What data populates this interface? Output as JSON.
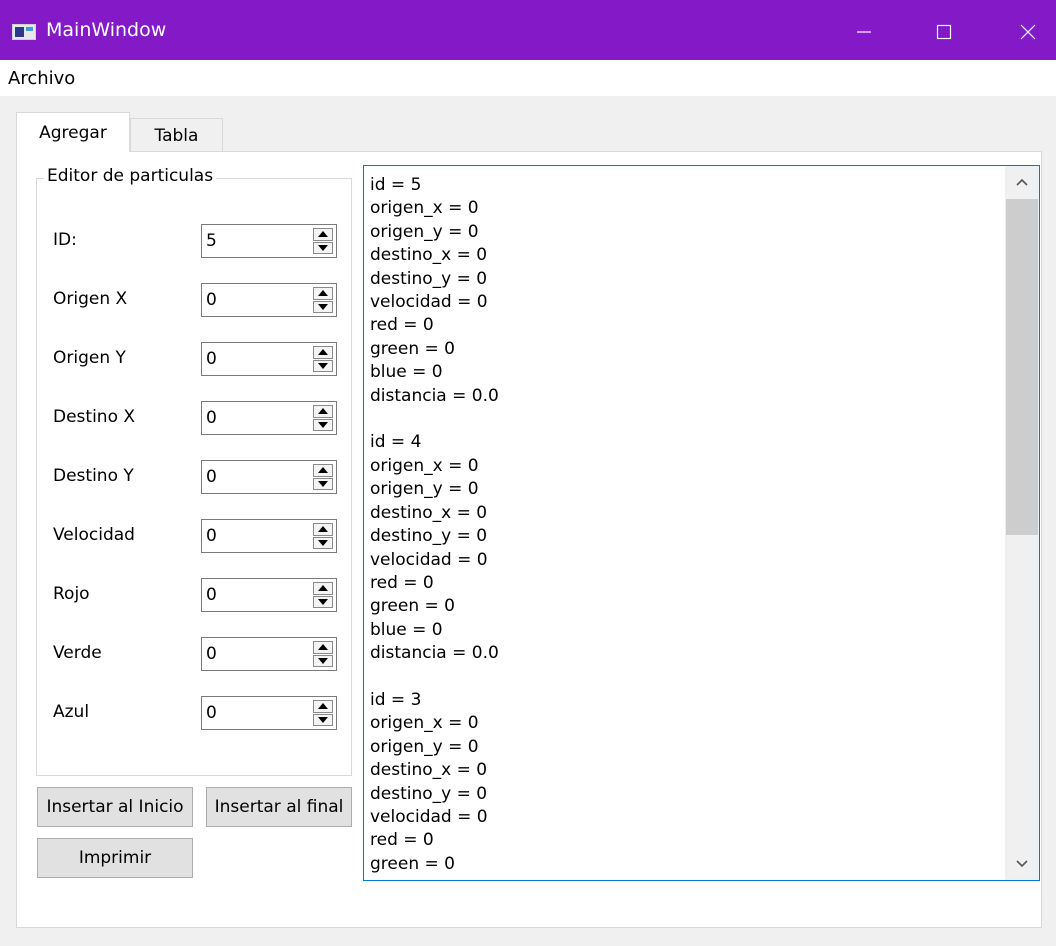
{
  "window": {
    "title": "MainWindow",
    "colors": {
      "titlebar": "#8419c7",
      "focus_border": "#0078d7"
    }
  },
  "menu": {
    "items": [
      "Archivo"
    ]
  },
  "tabs": [
    {
      "label": "Agregar",
      "active": true
    },
    {
      "label": "Tabla",
      "active": false
    }
  ],
  "editor": {
    "group_title": "Editor de particulas",
    "fields": [
      {
        "label": "ID:",
        "value": "5"
      },
      {
        "label": "Origen X",
        "value": "0"
      },
      {
        "label": "Origen Y",
        "value": "0"
      },
      {
        "label": "Destino X",
        "value": "0"
      },
      {
        "label": "Destino Y",
        "value": "0"
      },
      {
        "label": "Velocidad",
        "value": "0"
      },
      {
        "label": "Rojo",
        "value": "0"
      },
      {
        "label": "Verde",
        "value": "0"
      },
      {
        "label": "Azul",
        "value": "0"
      }
    ]
  },
  "buttons": {
    "insert_start": "Insertar al Inicio",
    "insert_end": "Insertar al final",
    "print": "Imprimir"
  },
  "output": {
    "text": "id = 5\norigen_x = 0\norigen_y = 0\ndestino_x = 0\ndestino_y = 0\nvelocidad = 0\nred = 0\ngreen = 0\nblue = 0\ndistancia = 0.0\n\nid = 4\norigen_x = 0\norigen_y = 0\ndestino_x = 0\ndestino_y = 0\nvelocidad = 0\nred = 0\ngreen = 0\nblue = 0\ndistancia = 0.0\n\nid = 3\norigen_x = 0\norigen_y = 0\ndestino_x = 0\ndestino_y = 0\nvelocidad = 0\nred = 0\ngreen = 0"
  }
}
